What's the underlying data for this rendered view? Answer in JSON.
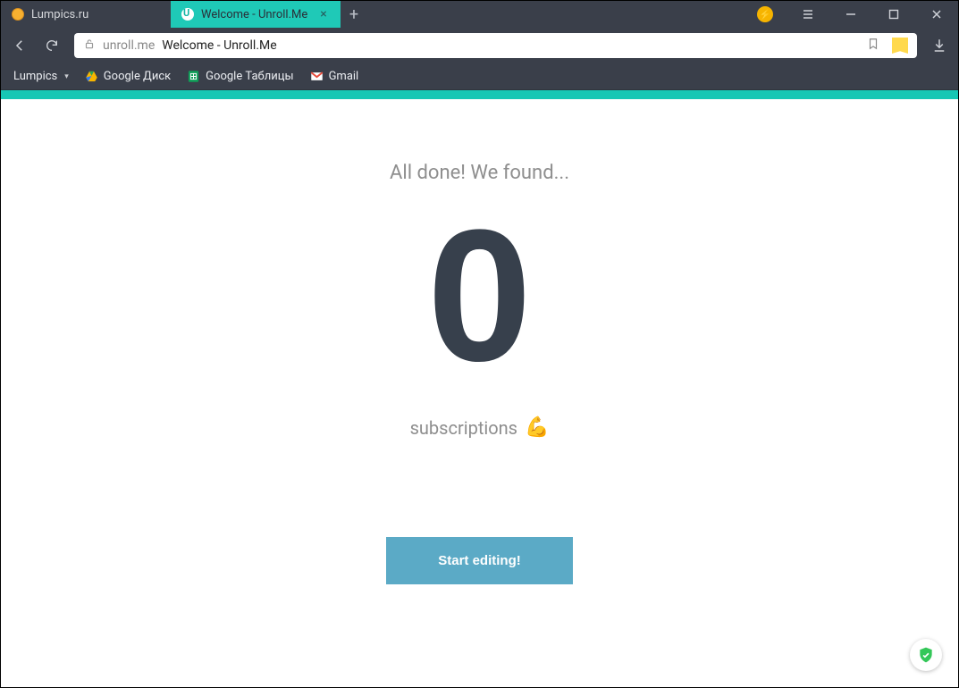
{
  "titlebar": {
    "tabs": [
      {
        "label": "Lumpics.ru",
        "active": false
      },
      {
        "label": "Welcome - Unroll.Me",
        "active": true
      }
    ]
  },
  "addressbar": {
    "host": "unroll.me",
    "title": "Welcome - Unroll.Me"
  },
  "bookmarks": {
    "menu_label": "Lumpics",
    "items": [
      {
        "label": "Google Диск",
        "icon": "drive-icon"
      },
      {
        "label": "Google Таблицы",
        "icon": "sheets-icon"
      },
      {
        "label": "Gmail",
        "icon": "gmail-icon"
      }
    ]
  },
  "main": {
    "headline": "All done! We found...",
    "count": "0",
    "subline": "subscriptions",
    "emoji": "💪",
    "cta_label": "Start editing!"
  },
  "colors": {
    "brand_teal": "#16c7b4",
    "chrome_dark": "#3a3f4a",
    "cta_blue": "#5baac6",
    "text_muted": "#8e8e8e",
    "num_dark": "#37404c"
  }
}
